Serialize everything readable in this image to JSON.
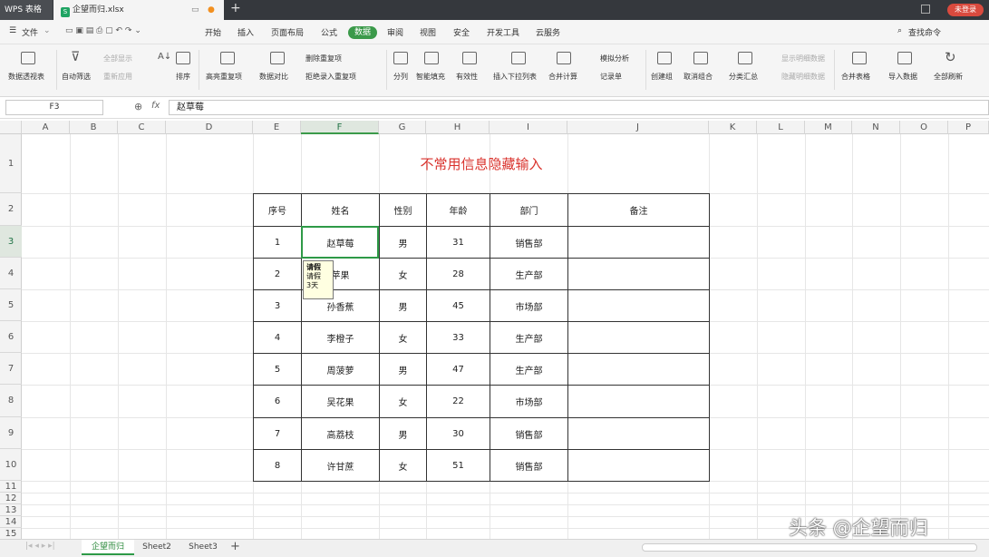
{
  "titlebar": {
    "app_tab": "WPS 表格",
    "file_tab": "企望而归.xlsx",
    "login_badge": "未登录"
  },
  "menubar": {
    "file_menu": "文件",
    "items": [
      "开始",
      "插入",
      "页面布局",
      "公式",
      "数据",
      "审阅",
      "视图",
      "安全",
      "开发工具",
      "云服务"
    ],
    "active": "数据",
    "search": "查找命令"
  },
  "ribbon": {
    "pivot": "数据透视表",
    "autofilter": "自动筛选",
    "show_all": "全部显示",
    "reapply": "重新应用",
    "sort": "排序",
    "highlight_dup": "高亮重复项",
    "compare": "数据对比",
    "remove_dup": "删除重复项",
    "reject_dup": "拒绝录入重复项",
    "split": "分列",
    "smart_fill": "智能填充",
    "validity": "有效性",
    "dropdown": "插入下拉列表",
    "consolidate": "合并计算",
    "simulation": "模拟分析",
    "record": "记录单",
    "group": "创建组",
    "ungroup": "取消组合",
    "subtotal": "分类汇总",
    "show_detail": "显示明细数据",
    "hide_detail": "隐藏明细数据",
    "merge_tables": "合并表格",
    "import": "导入数据",
    "refresh_all": "全部刷新"
  },
  "formula": {
    "name_box": "F3",
    "fx": "fx",
    "content": "赵草莓"
  },
  "columns": [
    "A",
    "B",
    "C",
    "D",
    "E",
    "F",
    "G",
    "H",
    "I",
    "J",
    "K",
    "L",
    "M",
    "N",
    "O",
    "P"
  ],
  "rows": [
    "1",
    "2",
    "3",
    "4",
    "5",
    "6",
    "7",
    "8",
    "9",
    "10",
    "11",
    "12",
    "13",
    "14",
    "15"
  ],
  "sheet": {
    "title": "不常用信息隐藏输入",
    "headers": [
      "序号",
      "姓名",
      "性别",
      "年龄",
      "部门",
      "备注"
    ],
    "data": [
      [
        "1",
        "赵草莓",
        "男",
        "31",
        "销售部",
        ""
      ],
      [
        "2",
        "苹果",
        "女",
        "28",
        "生产部",
        ""
      ],
      [
        "3",
        "孙香蕉",
        "男",
        "45",
        "市场部",
        ""
      ],
      [
        "4",
        "李橙子",
        "女",
        "33",
        "生产部",
        ""
      ],
      [
        "5",
        "周菠萝",
        "男",
        "47",
        "生产部",
        ""
      ],
      [
        "6",
        "吴花果",
        "女",
        "22",
        "市场部",
        ""
      ],
      [
        "7",
        "高荔枝",
        "男",
        "30",
        "销售部",
        ""
      ],
      [
        "8",
        "许甘蔗",
        "女",
        "51",
        "销售部",
        ""
      ]
    ]
  },
  "comment": {
    "title": "请假",
    "line1": "请假",
    "line2": "3天"
  },
  "sheet_tabs": [
    "企望而归",
    "Sheet2",
    "Sheet3"
  ],
  "watermark": "头条 @企望而归"
}
